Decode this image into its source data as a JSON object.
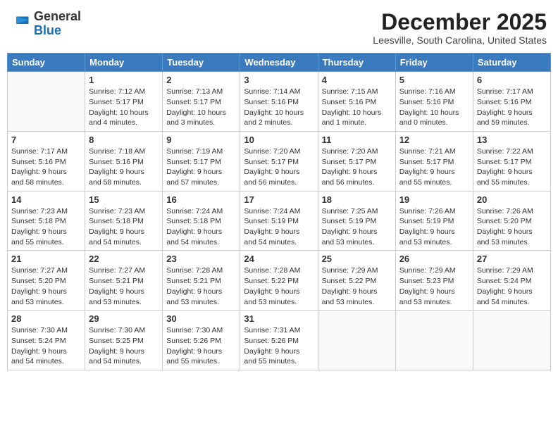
{
  "logo": {
    "general": "General",
    "blue": "Blue"
  },
  "title": "December 2025",
  "location": "Leesville, South Carolina, United States",
  "days_of_week": [
    "Sunday",
    "Monday",
    "Tuesday",
    "Wednesday",
    "Thursday",
    "Friday",
    "Saturday"
  ],
  "weeks": [
    [
      {
        "day": "",
        "info": ""
      },
      {
        "day": "1",
        "info": "Sunrise: 7:12 AM\nSunset: 5:17 PM\nDaylight: 10 hours\nand 4 minutes."
      },
      {
        "day": "2",
        "info": "Sunrise: 7:13 AM\nSunset: 5:17 PM\nDaylight: 10 hours\nand 3 minutes."
      },
      {
        "day": "3",
        "info": "Sunrise: 7:14 AM\nSunset: 5:16 PM\nDaylight: 10 hours\nand 2 minutes."
      },
      {
        "day": "4",
        "info": "Sunrise: 7:15 AM\nSunset: 5:16 PM\nDaylight: 10 hours\nand 1 minute."
      },
      {
        "day": "5",
        "info": "Sunrise: 7:16 AM\nSunset: 5:16 PM\nDaylight: 10 hours\nand 0 minutes."
      },
      {
        "day": "6",
        "info": "Sunrise: 7:17 AM\nSunset: 5:16 PM\nDaylight: 9 hours\nand 59 minutes."
      }
    ],
    [
      {
        "day": "7",
        "info": "Sunrise: 7:17 AM\nSunset: 5:16 PM\nDaylight: 9 hours\nand 58 minutes."
      },
      {
        "day": "8",
        "info": "Sunrise: 7:18 AM\nSunset: 5:16 PM\nDaylight: 9 hours\nand 58 minutes."
      },
      {
        "day": "9",
        "info": "Sunrise: 7:19 AM\nSunset: 5:17 PM\nDaylight: 9 hours\nand 57 minutes."
      },
      {
        "day": "10",
        "info": "Sunrise: 7:20 AM\nSunset: 5:17 PM\nDaylight: 9 hours\nand 56 minutes."
      },
      {
        "day": "11",
        "info": "Sunrise: 7:20 AM\nSunset: 5:17 PM\nDaylight: 9 hours\nand 56 minutes."
      },
      {
        "day": "12",
        "info": "Sunrise: 7:21 AM\nSunset: 5:17 PM\nDaylight: 9 hours\nand 55 minutes."
      },
      {
        "day": "13",
        "info": "Sunrise: 7:22 AM\nSunset: 5:17 PM\nDaylight: 9 hours\nand 55 minutes."
      }
    ],
    [
      {
        "day": "14",
        "info": "Sunrise: 7:23 AM\nSunset: 5:18 PM\nDaylight: 9 hours\nand 55 minutes."
      },
      {
        "day": "15",
        "info": "Sunrise: 7:23 AM\nSunset: 5:18 PM\nDaylight: 9 hours\nand 54 minutes."
      },
      {
        "day": "16",
        "info": "Sunrise: 7:24 AM\nSunset: 5:18 PM\nDaylight: 9 hours\nand 54 minutes."
      },
      {
        "day": "17",
        "info": "Sunrise: 7:24 AM\nSunset: 5:19 PM\nDaylight: 9 hours\nand 54 minutes."
      },
      {
        "day": "18",
        "info": "Sunrise: 7:25 AM\nSunset: 5:19 PM\nDaylight: 9 hours\nand 53 minutes."
      },
      {
        "day": "19",
        "info": "Sunrise: 7:26 AM\nSunset: 5:19 PM\nDaylight: 9 hours\nand 53 minutes."
      },
      {
        "day": "20",
        "info": "Sunrise: 7:26 AM\nSunset: 5:20 PM\nDaylight: 9 hours\nand 53 minutes."
      }
    ],
    [
      {
        "day": "21",
        "info": "Sunrise: 7:27 AM\nSunset: 5:20 PM\nDaylight: 9 hours\nand 53 minutes."
      },
      {
        "day": "22",
        "info": "Sunrise: 7:27 AM\nSunset: 5:21 PM\nDaylight: 9 hours\nand 53 minutes."
      },
      {
        "day": "23",
        "info": "Sunrise: 7:28 AM\nSunset: 5:21 PM\nDaylight: 9 hours\nand 53 minutes."
      },
      {
        "day": "24",
        "info": "Sunrise: 7:28 AM\nSunset: 5:22 PM\nDaylight: 9 hours\nand 53 minutes."
      },
      {
        "day": "25",
        "info": "Sunrise: 7:29 AM\nSunset: 5:22 PM\nDaylight: 9 hours\nand 53 minutes."
      },
      {
        "day": "26",
        "info": "Sunrise: 7:29 AM\nSunset: 5:23 PM\nDaylight: 9 hours\nand 53 minutes."
      },
      {
        "day": "27",
        "info": "Sunrise: 7:29 AM\nSunset: 5:24 PM\nDaylight: 9 hours\nand 54 minutes."
      }
    ],
    [
      {
        "day": "28",
        "info": "Sunrise: 7:30 AM\nSunset: 5:24 PM\nDaylight: 9 hours\nand 54 minutes."
      },
      {
        "day": "29",
        "info": "Sunrise: 7:30 AM\nSunset: 5:25 PM\nDaylight: 9 hours\nand 54 minutes."
      },
      {
        "day": "30",
        "info": "Sunrise: 7:30 AM\nSunset: 5:26 PM\nDaylight: 9 hours\nand 55 minutes."
      },
      {
        "day": "31",
        "info": "Sunrise: 7:31 AM\nSunset: 5:26 PM\nDaylight: 9 hours\nand 55 minutes."
      },
      {
        "day": "",
        "info": ""
      },
      {
        "day": "",
        "info": ""
      },
      {
        "day": "",
        "info": ""
      }
    ]
  ]
}
